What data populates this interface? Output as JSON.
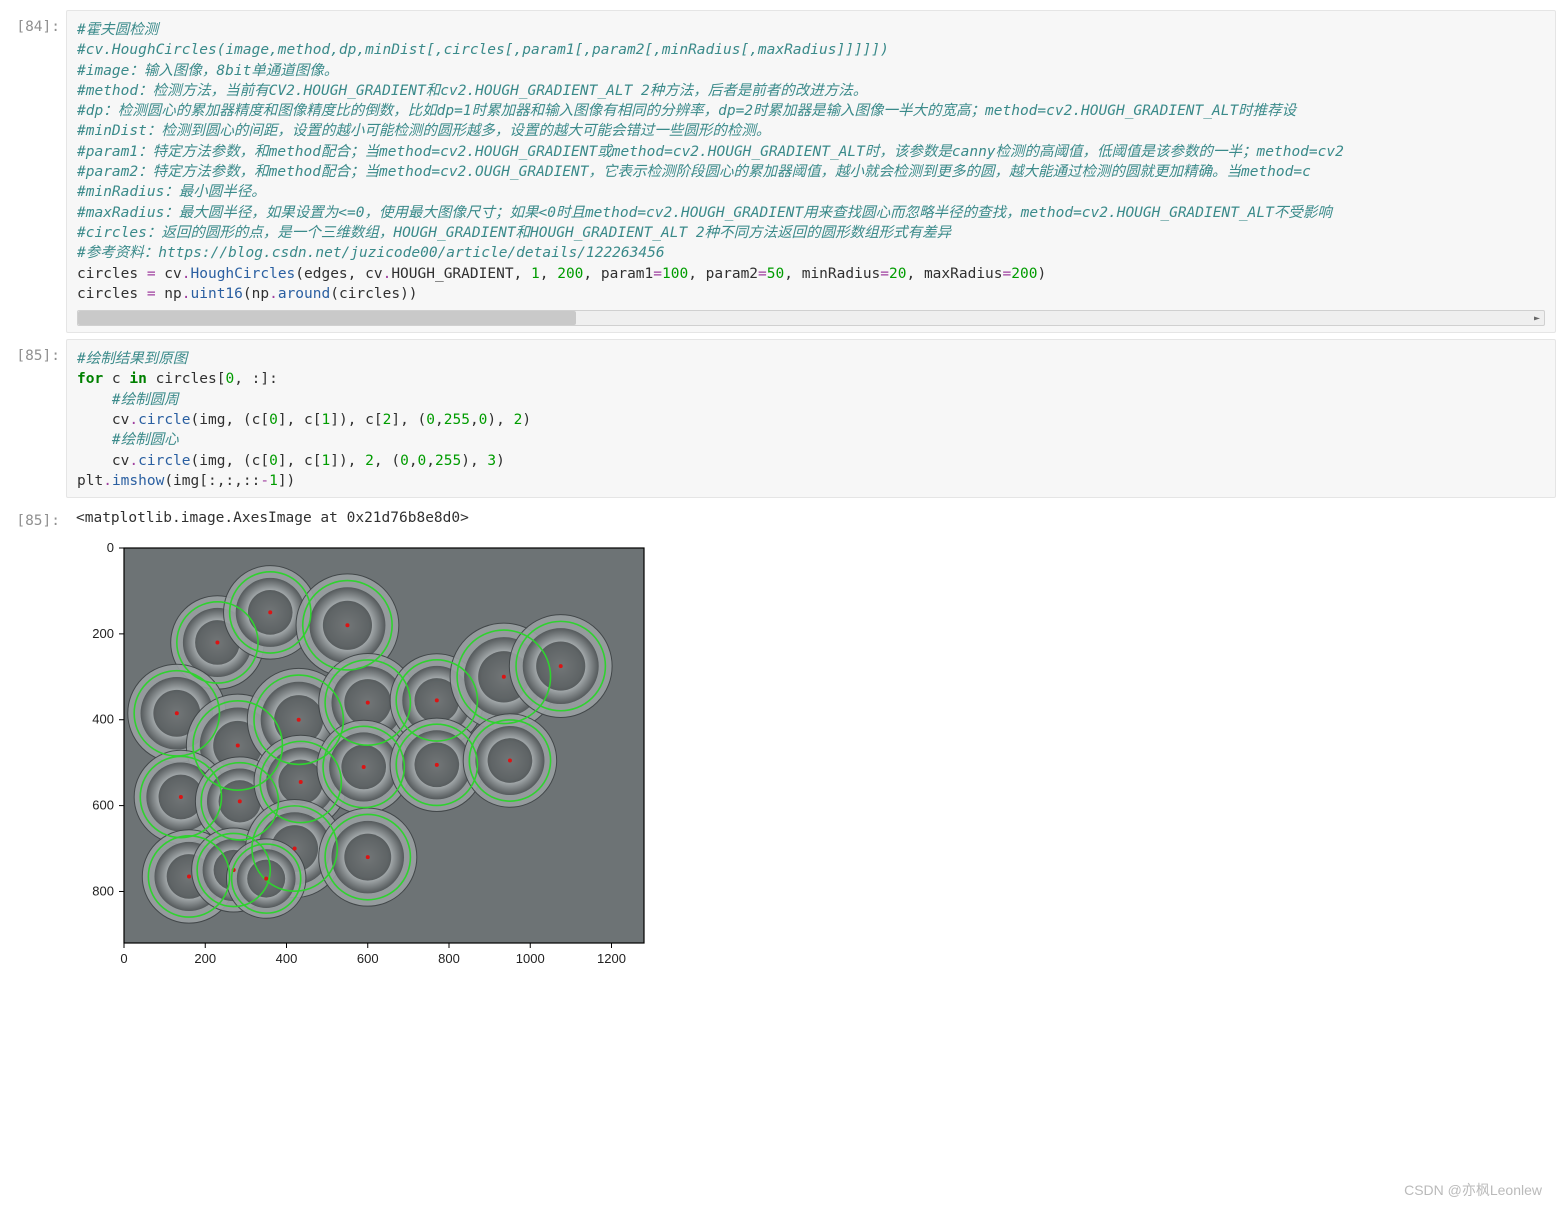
{
  "watermark": "CSDN @亦枫Leonlew",
  "cells": {
    "c84": {
      "prompt": "[84]:",
      "lines": [
        "#霍夫圆检测",
        "#cv.HoughCircles(image,method,dp,minDist[,circles[,param1[,param2[,minRadius[,maxRadius]]]]])",
        "#image：输入图像，8bit单通道图像。",
        "#method：检测方法，当前有CV2.HOUGH_GRADIENT和cv2.HOUGH_GRADIENT_ALT 2种方法，后者是前者的改进方法。",
        "#dp：检测圆心的累加器精度和图像精度比的倒数，比如dp=1时累加器和输入图像有相同的分辨率，dp=2时累加器是输入图像一半大的宽高；method=cv2.HOUGH_GRADIENT_ALT时推荐设",
        "#minDist：检测到圆心的间距，设置的越小可能检测的圆形越多，设置的越大可能会错过一些圆形的检测。",
        "#param1：特定方法参数，和method配合；当method=cv2.HOUGH_GRADIENT或method=cv2.HOUGH_GRADIENT_ALT时，该参数是canny检测的高阈值，低阈值是该参数的一半；method=cv2",
        "#param2：特定方法参数，和method配合；当method=cv2.OUGH_GRADIENT，它表示检测阶段圆心的累加器阈值，越小就会检测到更多的圆，越大能通过检测的圆就更加精确。当method=c",
        "#minRadius：最小圆半径。",
        "#maxRadius：最大圆半径，如果设置为<=0，使用最大图像尺寸；如果<0时且method=cv2.HOUGH_GRADIENT用来查找圆心而忽略半径的查找，method=cv2.HOUGH_GRADIENT_ALT不受影响",
        "#circles：返回的圆形的点，是一个三维数组，HOUGH_GRADIENT和HOUGH_GRADIENT_ALT 2种不同方法返回的圆形数组形式有差异",
        "#参考资料：https://blog.csdn.net/juzicode00/article/details/122263456"
      ],
      "call1": {
        "pre": "circles ",
        "assign": "=",
        "mod": " cv",
        "dot": ".",
        "fn": "HoughCircles",
        "open": "(edges, cv",
        "dot2": ".",
        "const": "HOUGH_GRADIENT",
        "args_a": ", ",
        "n1": "1",
        "args_b": ", ",
        "n2": "200",
        "args_c": ", param1",
        "eq1": "=",
        "n3": "100",
        "args_d": ", param2",
        "eq2": "=",
        "n4": "50",
        "args_e": ", minRadius",
        "eq3": "=",
        "n5": "20",
        "args_f": ", maxRadius",
        "eq4": "=",
        "n6": "200",
        "close": ")"
      },
      "call2": {
        "pre": "circles ",
        "assign": "=",
        "mod": " np",
        "dot": ".",
        "fn": "uint16",
        "open": "(np",
        "dot2": ".",
        "fn2": "around",
        "rest": "(circles))"
      }
    },
    "c85code": {
      "prompt": "[85]:",
      "l1": "#绘制结果到原图",
      "l2": {
        "for": "for",
        "mid": " c ",
        "in": "in",
        "rest_a": " circles[",
        "n0": "0",
        "rest_b": ", :]:"
      },
      "l3": "    #绘制圆周",
      "l4": {
        "indent": "    cv",
        "dot": ".",
        "fn": "circle",
        "a": "(img, (c[",
        "n0": "0",
        "b": "], c[",
        "n1": "1",
        "c": "]), c[",
        "n2": "2",
        "d": "], (",
        "v0": "0",
        "e": ",",
        "v1": "255",
        "f": ",",
        "v2": "0",
        "g": "), ",
        "th": "2",
        "h": ")"
      },
      "l5": "    #绘制圆心",
      "l6": {
        "indent": "    cv",
        "dot": ".",
        "fn": "circle",
        "a": "(img, (c[",
        "n0": "0",
        "b": "], c[",
        "n1": "1",
        "c": "]), ",
        "r": "2",
        "d": ", (",
        "v0": "0",
        "e": ",",
        "v1": "0",
        "f": ",",
        "v2": "255",
        "g": "), ",
        "th": "3",
        "h": ")"
      },
      "l7": {
        "pre": "plt",
        "dot": ".",
        "fn": "imshow",
        "a": "(img[:,:,::",
        "neg": "-",
        "one": "1",
        "b": "])"
      }
    },
    "c85out": {
      "prompt": "[85]:",
      "text": "<matplotlib.image.AxesImage at 0x21d76b8e8d0>"
    }
  },
  "chart_data": {
    "type": "image-with-overlays",
    "title": "",
    "xlabel": "",
    "ylabel": "",
    "xlim": [
      0,
      1280
    ],
    "ylim": [
      0,
      920
    ],
    "xticks": [
      0,
      200,
      400,
      600,
      800,
      1000,
      1200
    ],
    "yticks": [
      0,
      200,
      400,
      600,
      800
    ],
    "circles": [
      {
        "x": 230,
        "y": 220,
        "r": 100
      },
      {
        "x": 360,
        "y": 150,
        "r": 100
      },
      {
        "x": 550,
        "y": 180,
        "r": 110
      },
      {
        "x": 130,
        "y": 385,
        "r": 105
      },
      {
        "x": 280,
        "y": 460,
        "r": 110
      },
      {
        "x": 430,
        "y": 400,
        "r": 110
      },
      {
        "x": 600,
        "y": 360,
        "r": 105
      },
      {
        "x": 770,
        "y": 355,
        "r": 100
      },
      {
        "x": 935,
        "y": 300,
        "r": 115
      },
      {
        "x": 1075,
        "y": 275,
        "r": 110
      },
      {
        "x": 140,
        "y": 580,
        "r": 100
      },
      {
        "x": 285,
        "y": 590,
        "r": 95
      },
      {
        "x": 435,
        "y": 545,
        "r": 100
      },
      {
        "x": 590,
        "y": 510,
        "r": 100
      },
      {
        "x": 770,
        "y": 505,
        "r": 100
      },
      {
        "x": 950,
        "y": 495,
        "r": 100
      },
      {
        "x": 160,
        "y": 765,
        "r": 100
      },
      {
        "x": 270,
        "y": 750,
        "r": 90
      },
      {
        "x": 420,
        "y": 700,
        "r": 105
      },
      {
        "x": 600,
        "y": 720,
        "r": 105
      },
      {
        "x": 350,
        "y": 770,
        "r": 85
      }
    ],
    "colors": {
      "circle_stroke": "#2fd22f",
      "center_dot": "#dc1414"
    }
  }
}
